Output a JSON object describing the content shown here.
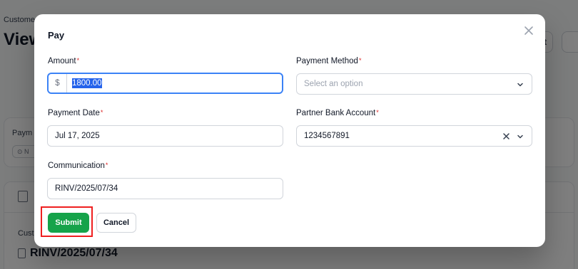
{
  "background": {
    "breadcrumb": "Custome",
    "title": "View",
    "btn_partial": "t",
    "card_label": "Paym",
    "chip_label": "N",
    "card2_label": "Cust",
    "doc_name": "RINV/2025/07/34"
  },
  "modal": {
    "title": "Pay",
    "amount": {
      "label": "Amount",
      "prefix": "$",
      "value": "1800.00"
    },
    "payment_method": {
      "label": "Payment Method",
      "placeholder": "Select an option"
    },
    "payment_date": {
      "label": "Payment Date",
      "value": "Jul 17, 2025"
    },
    "partner_bank_account": {
      "label": "Partner Bank Account",
      "value": "1234567891"
    },
    "communication": {
      "label": "Communication",
      "value": "RINV/2025/07/34"
    },
    "required_mark": "*",
    "submit_label": "Submit",
    "cancel_label": "Cancel"
  },
  "colors": {
    "submit": "#16a34a",
    "focus": "#3b82f6",
    "highlight": "#ef1f1f",
    "required": "#dc2626"
  }
}
